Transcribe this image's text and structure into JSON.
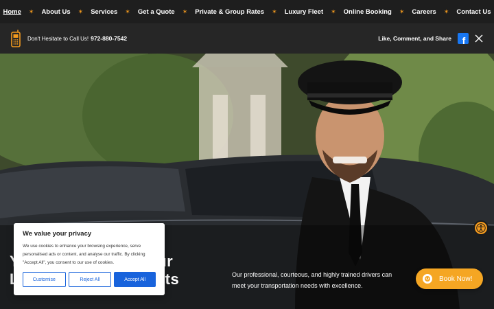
{
  "nav": {
    "items": [
      {
        "label": "Home",
        "active": true
      },
      {
        "label": "About Us"
      },
      {
        "label": "Services"
      },
      {
        "label": "Get a Quote"
      },
      {
        "label": "Private & Group Rates"
      },
      {
        "label": "Luxury Fleet"
      },
      {
        "label": "Online Booking"
      },
      {
        "label": "Careers"
      },
      {
        "label": "Contact Us"
      }
    ],
    "separator_color": "#f39a1e"
  },
  "infobar": {
    "call_text": "Don't Hesitate to Call Us!",
    "phone": "972-880-7542",
    "social_label": "Like, Comment, and Share",
    "icons": [
      "phone-icon",
      "facebook-icon",
      "x-icon"
    ]
  },
  "hero": {
    "title_partial": "Y           ur\nL                ents",
    "title_line1_left": "Y",
    "title_line1_right": "ur",
    "title_line2_left": "L",
    "title_line2_right": "ents",
    "description": "Our professional, courteous, and highly trained drivers can meet your transportation needs with excellence."
  },
  "cookie": {
    "title": "We value your privacy",
    "text": "We use cookies to enhance your browsing experience, serve personalised ads or content, and analyse our traffic. By clicking \"Accept All\", you consent to our use of cookies.",
    "customise": "Customise",
    "reject": "Reject All",
    "accept": "Accept All",
    "accent": "#1863dc"
  },
  "booknow": {
    "label": "Book Now!",
    "color": "#f5a623"
  },
  "accessibility": {
    "icon": "accessibility-icon",
    "color": "#f39a1e"
  }
}
